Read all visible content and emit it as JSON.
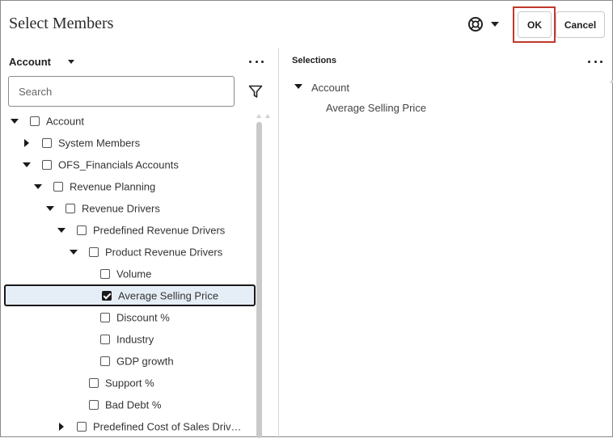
{
  "dialog": {
    "title": "Select Members"
  },
  "header": {
    "ok_label": "OK",
    "cancel_label": "Cancel"
  },
  "left": {
    "dimension_label": "Account",
    "search_placeholder": "Search"
  },
  "tree": [
    {
      "label": "Account",
      "checked": false,
      "toggle": "down"
    },
    {
      "label": "System Members",
      "checked": false,
      "toggle": "right"
    },
    {
      "label": "OFS_Financials Accounts",
      "checked": false,
      "toggle": "down"
    },
    {
      "label": "Revenue Planning",
      "checked": false,
      "toggle": "down"
    },
    {
      "label": "Revenue Drivers",
      "checked": false,
      "toggle": "down"
    },
    {
      "label": "Predefined Revenue Drivers",
      "checked": false,
      "toggle": "down"
    },
    {
      "label": "Product Revenue Drivers",
      "checked": false,
      "toggle": "down"
    },
    {
      "label": "Volume",
      "checked": false,
      "toggle": "none"
    },
    {
      "label": "Average Selling Price",
      "checked": true,
      "toggle": "none"
    },
    {
      "label": "Discount %",
      "checked": false,
      "toggle": "none"
    },
    {
      "label": "Industry",
      "checked": false,
      "toggle": "none"
    },
    {
      "label": "GDP growth",
      "checked": false,
      "toggle": "none"
    },
    {
      "label": "Support %",
      "checked": false,
      "toggle": "none"
    },
    {
      "label": "Bad Debt %",
      "checked": false,
      "toggle": "none"
    },
    {
      "label": "Predefined Cost of Sales Driv…",
      "checked": false,
      "toggle": "right"
    }
  ],
  "selections": {
    "title": "Selections",
    "root": "Account",
    "items": [
      "Average Selling Price"
    ]
  },
  "colors": {
    "highlight_outline": "#c0392b",
    "selected_row_bg": "#e5eef7"
  }
}
